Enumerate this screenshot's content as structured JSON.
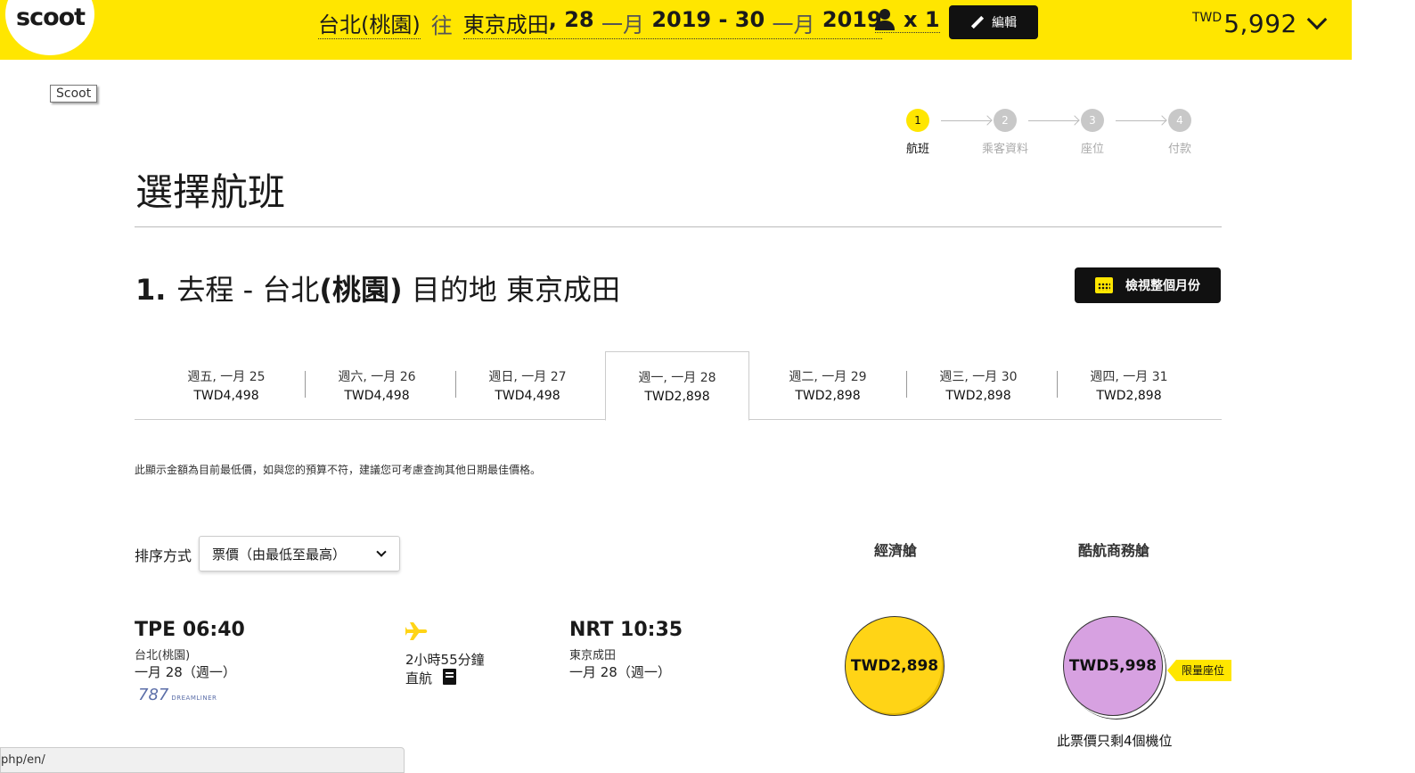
{
  "header": {
    "logo": "scoot",
    "trip": {
      "origin": "台北(桃園)",
      "to_word": "往",
      "destination": "東京成田",
      "dates_prefix": ", 28 ",
      "month1": "一月",
      "dates_mid": " 2019 - 30 ",
      "month2": "一月",
      "dates_suffix": " 2019"
    },
    "pax_count": "x 1",
    "edit_label": "編輯",
    "total_currency": "TWD",
    "total_amount": "5,992"
  },
  "tooltip": "Scoot",
  "stepper": [
    {
      "num": "1",
      "label": "航班"
    },
    {
      "num": "2",
      "label": "乘客資料"
    },
    {
      "num": "3",
      "label": "座位"
    },
    {
      "num": "4",
      "label": "付款"
    }
  ],
  "page_title": "選擇航班",
  "route": {
    "num": "1.",
    "text_a": "去程 - 台北",
    "text_b": "(桃園)",
    "text_c": " 目的地 東京成田"
  },
  "view_month_label": "檢視整個月份",
  "date_tabs": [
    {
      "day": "週五, 一月 25",
      "price": "TWD4,498"
    },
    {
      "day": "週六, 一月 26",
      "price": "TWD4,498"
    },
    {
      "day": "週日, 一月 27",
      "price": "TWD4,498"
    },
    {
      "day": "週一, 一月 28",
      "price": "TWD2,898"
    },
    {
      "day": "週二, 一月 29",
      "price": "TWD2,898"
    },
    {
      "day": "週三, 一月 30",
      "price": "TWD2,898"
    },
    {
      "day": "週四, 一月 31",
      "price": "TWD2,898"
    }
  ],
  "note": "此顯示金額為目前最低價，如與您的預算不符，建議您可考慮查詢其他日期最佳價格。",
  "sort": {
    "label": "排序方式",
    "selected": "票價（由最低至最高）"
  },
  "columns": {
    "economy": "經濟艙",
    "business": "酷航商務艙"
  },
  "flight": {
    "dep_code_time": "TPE 06:40",
    "dep_city": "台北(桃園)",
    "dep_date": "一月 28（週一）",
    "aircraft_num": "787",
    "aircraft_name": "DREAMLINER",
    "duration": "2小時55分鐘",
    "stops": "直航",
    "arr_code_time": "NRT 10:35",
    "arr_city": "東京成田",
    "arr_date": "一月 28（週一）",
    "economy_price": "TWD2,898",
    "business_price": "TWD5,998",
    "limited_badge": "限量座位",
    "seats_left": "此票價只剩4個機位"
  },
  "status_url": "php/en/",
  "colors": {
    "brand_yellow": "#ffe600",
    "economy_bubble": "#ffd416",
    "business_bubble": "#d7a1e1"
  }
}
